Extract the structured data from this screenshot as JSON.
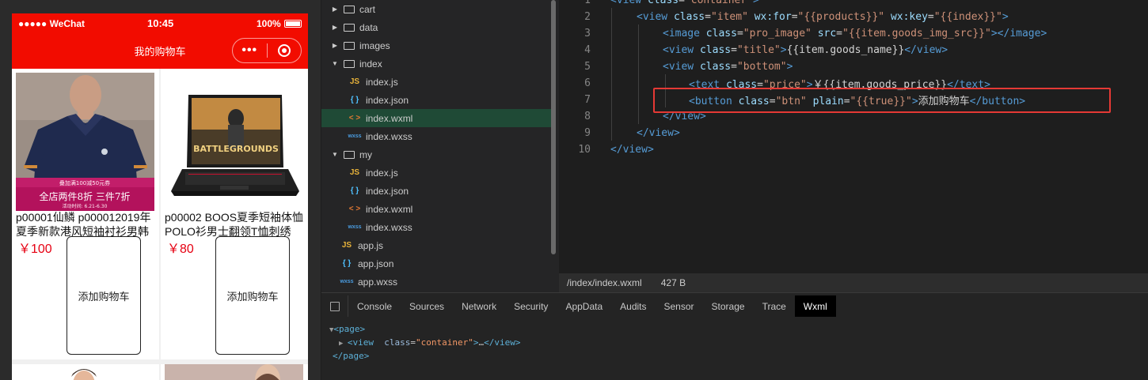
{
  "simulator": {
    "status": {
      "carrier": "●●●●● WeChat",
      "time": "10:45",
      "battery": "100%"
    },
    "nav_title": "我的购物车",
    "capsule_more": "•••",
    "products": [
      {
        "name": "p00001仙鳞 p000012019年夏季新款港风短袖衬衫男韩版休...",
        "price": "￥100",
        "button": "添加购物车",
        "promo_top": "叠加满100减50元券",
        "promo_main": "全店两件8折 三件7折",
        "promo_date": "活动时间: 6.21-6.30"
      },
      {
        "name": "p00002 BOOS夏季短袖体恤POLO衫男士翻领T恤刺绣上...",
        "price": "￥80",
        "button": "添加购物车",
        "game_title": "BATTLEGROUNDS"
      }
    ]
  },
  "explorer": {
    "items": [
      {
        "type": "folder",
        "label": "cart",
        "expanded": false
      },
      {
        "type": "folder",
        "label": "data",
        "expanded": false
      },
      {
        "type": "folder",
        "label": "images",
        "expanded": false
      },
      {
        "type": "folder",
        "label": "index",
        "expanded": true
      },
      {
        "type": "js",
        "label": "index.js"
      },
      {
        "type": "json",
        "label": "index.json"
      },
      {
        "type": "wxml",
        "label": "index.wxml",
        "active": true
      },
      {
        "type": "wxss",
        "label": "index.wxss"
      },
      {
        "type": "folder",
        "label": "my",
        "expanded": true
      },
      {
        "type": "js",
        "label": "index.js"
      },
      {
        "type": "json",
        "label": "index.json"
      },
      {
        "type": "wxml",
        "label": "index.wxml"
      },
      {
        "type": "wxss",
        "label": "index.wxss"
      },
      {
        "type": "js",
        "label": "app.js",
        "root": true
      },
      {
        "type": "json",
        "label": "app.json",
        "root": true
      },
      {
        "type": "wxss",
        "label": "app.wxss",
        "root": true
      }
    ],
    "type_labels": {
      "js": "JS",
      "json": "{ }",
      "wxml": "< >",
      "wxss": "wxss"
    }
  },
  "editor": {
    "lines": [
      {
        "n": "1",
        "indent": 0,
        "tokens": [
          [
            "tag",
            "<view "
          ],
          [
            "attr",
            "class"
          ],
          [
            "txt",
            "="
          ],
          [
            "str",
            "\"container\""
          ],
          [
            "tag",
            ">"
          ]
        ]
      },
      {
        "n": "2",
        "indent": 1,
        "tokens": [
          [
            "tag",
            "<view "
          ],
          [
            "attr",
            "class"
          ],
          [
            "txt",
            "="
          ],
          [
            "str",
            "\"item\" "
          ],
          [
            "attr",
            "wx:for"
          ],
          [
            "txt",
            "="
          ],
          [
            "str",
            "\"{{products}}\" "
          ],
          [
            "attr",
            "wx:key"
          ],
          [
            "txt",
            "="
          ],
          [
            "str",
            "\"{{index}}\""
          ],
          [
            "tag",
            ">"
          ]
        ]
      },
      {
        "n": "3",
        "indent": 2,
        "tokens": [
          [
            "tag",
            "<image "
          ],
          [
            "attr",
            "class"
          ],
          [
            "txt",
            "="
          ],
          [
            "str",
            "\"pro_image\" "
          ],
          [
            "attr",
            "src"
          ],
          [
            "txt",
            "="
          ],
          [
            "str",
            "\"{{item.goods_img_src}}\""
          ],
          [
            "tag",
            "></image>"
          ]
        ]
      },
      {
        "n": "4",
        "indent": 2,
        "tokens": [
          [
            "tag",
            "<view "
          ],
          [
            "attr",
            "class"
          ],
          [
            "txt",
            "="
          ],
          [
            "str",
            "\"title\""
          ],
          [
            "tag",
            ">"
          ],
          [
            "txt",
            "{{item.goods_name}}"
          ],
          [
            "tag",
            "</view>"
          ]
        ]
      },
      {
        "n": "5",
        "indent": 2,
        "tokens": [
          [
            "tag",
            "<view "
          ],
          [
            "attr",
            "class"
          ],
          [
            "txt",
            "="
          ],
          [
            "str",
            "\"bottom\""
          ],
          [
            "tag",
            ">"
          ]
        ]
      },
      {
        "n": "6",
        "indent": 3,
        "tokens": [
          [
            "tag",
            "<text "
          ],
          [
            "attr",
            "class"
          ],
          [
            "txt",
            "="
          ],
          [
            "str",
            "\"price\""
          ],
          [
            "tag",
            ">"
          ],
          [
            "txt",
            "￥{{item.goods_price}}"
          ],
          [
            "tag",
            "</text>"
          ]
        ]
      },
      {
        "n": "7",
        "indent": 3,
        "tokens": [
          [
            "tag",
            "<button "
          ],
          [
            "attr",
            "class"
          ],
          [
            "txt",
            "="
          ],
          [
            "str",
            "\"btn\" "
          ],
          [
            "attr",
            "plain"
          ],
          [
            "txt",
            "="
          ],
          [
            "str",
            "\"{{true}}\""
          ],
          [
            "tag",
            ">"
          ],
          [
            "txt",
            "添加购物车"
          ],
          [
            "tag",
            "</button>"
          ]
        ]
      },
      {
        "n": "8",
        "indent": 2,
        "tokens": [
          [
            "tag",
            "</view>"
          ]
        ]
      },
      {
        "n": "9",
        "indent": 1,
        "tokens": [
          [
            "tag",
            "</view>"
          ]
        ]
      },
      {
        "n": "10",
        "indent": 0,
        "tokens": [
          [
            "tag",
            "</view>"
          ]
        ]
      }
    ],
    "status_path": "/index/index.wxml",
    "status_size": "427 B"
  },
  "devtools": {
    "tabs": [
      "Console",
      "Sources",
      "Network",
      "Security",
      "AppData",
      "Audits",
      "Sensor",
      "Storage",
      "Trace",
      "Wxml"
    ],
    "active_tab": "Wxml",
    "dom": {
      "page_open": "<page>",
      "view_tag": "view",
      "view_attr": "class",
      "view_val": "\"container\"",
      "view_ellipsis": "…",
      "view_close": "</view>",
      "page_close": "</page>"
    }
  },
  "colors": {
    "nav_red": "#f20c00",
    "price_red": "#e60012",
    "highlight_red": "#e53935",
    "active_row": "#1f4a36"
  }
}
